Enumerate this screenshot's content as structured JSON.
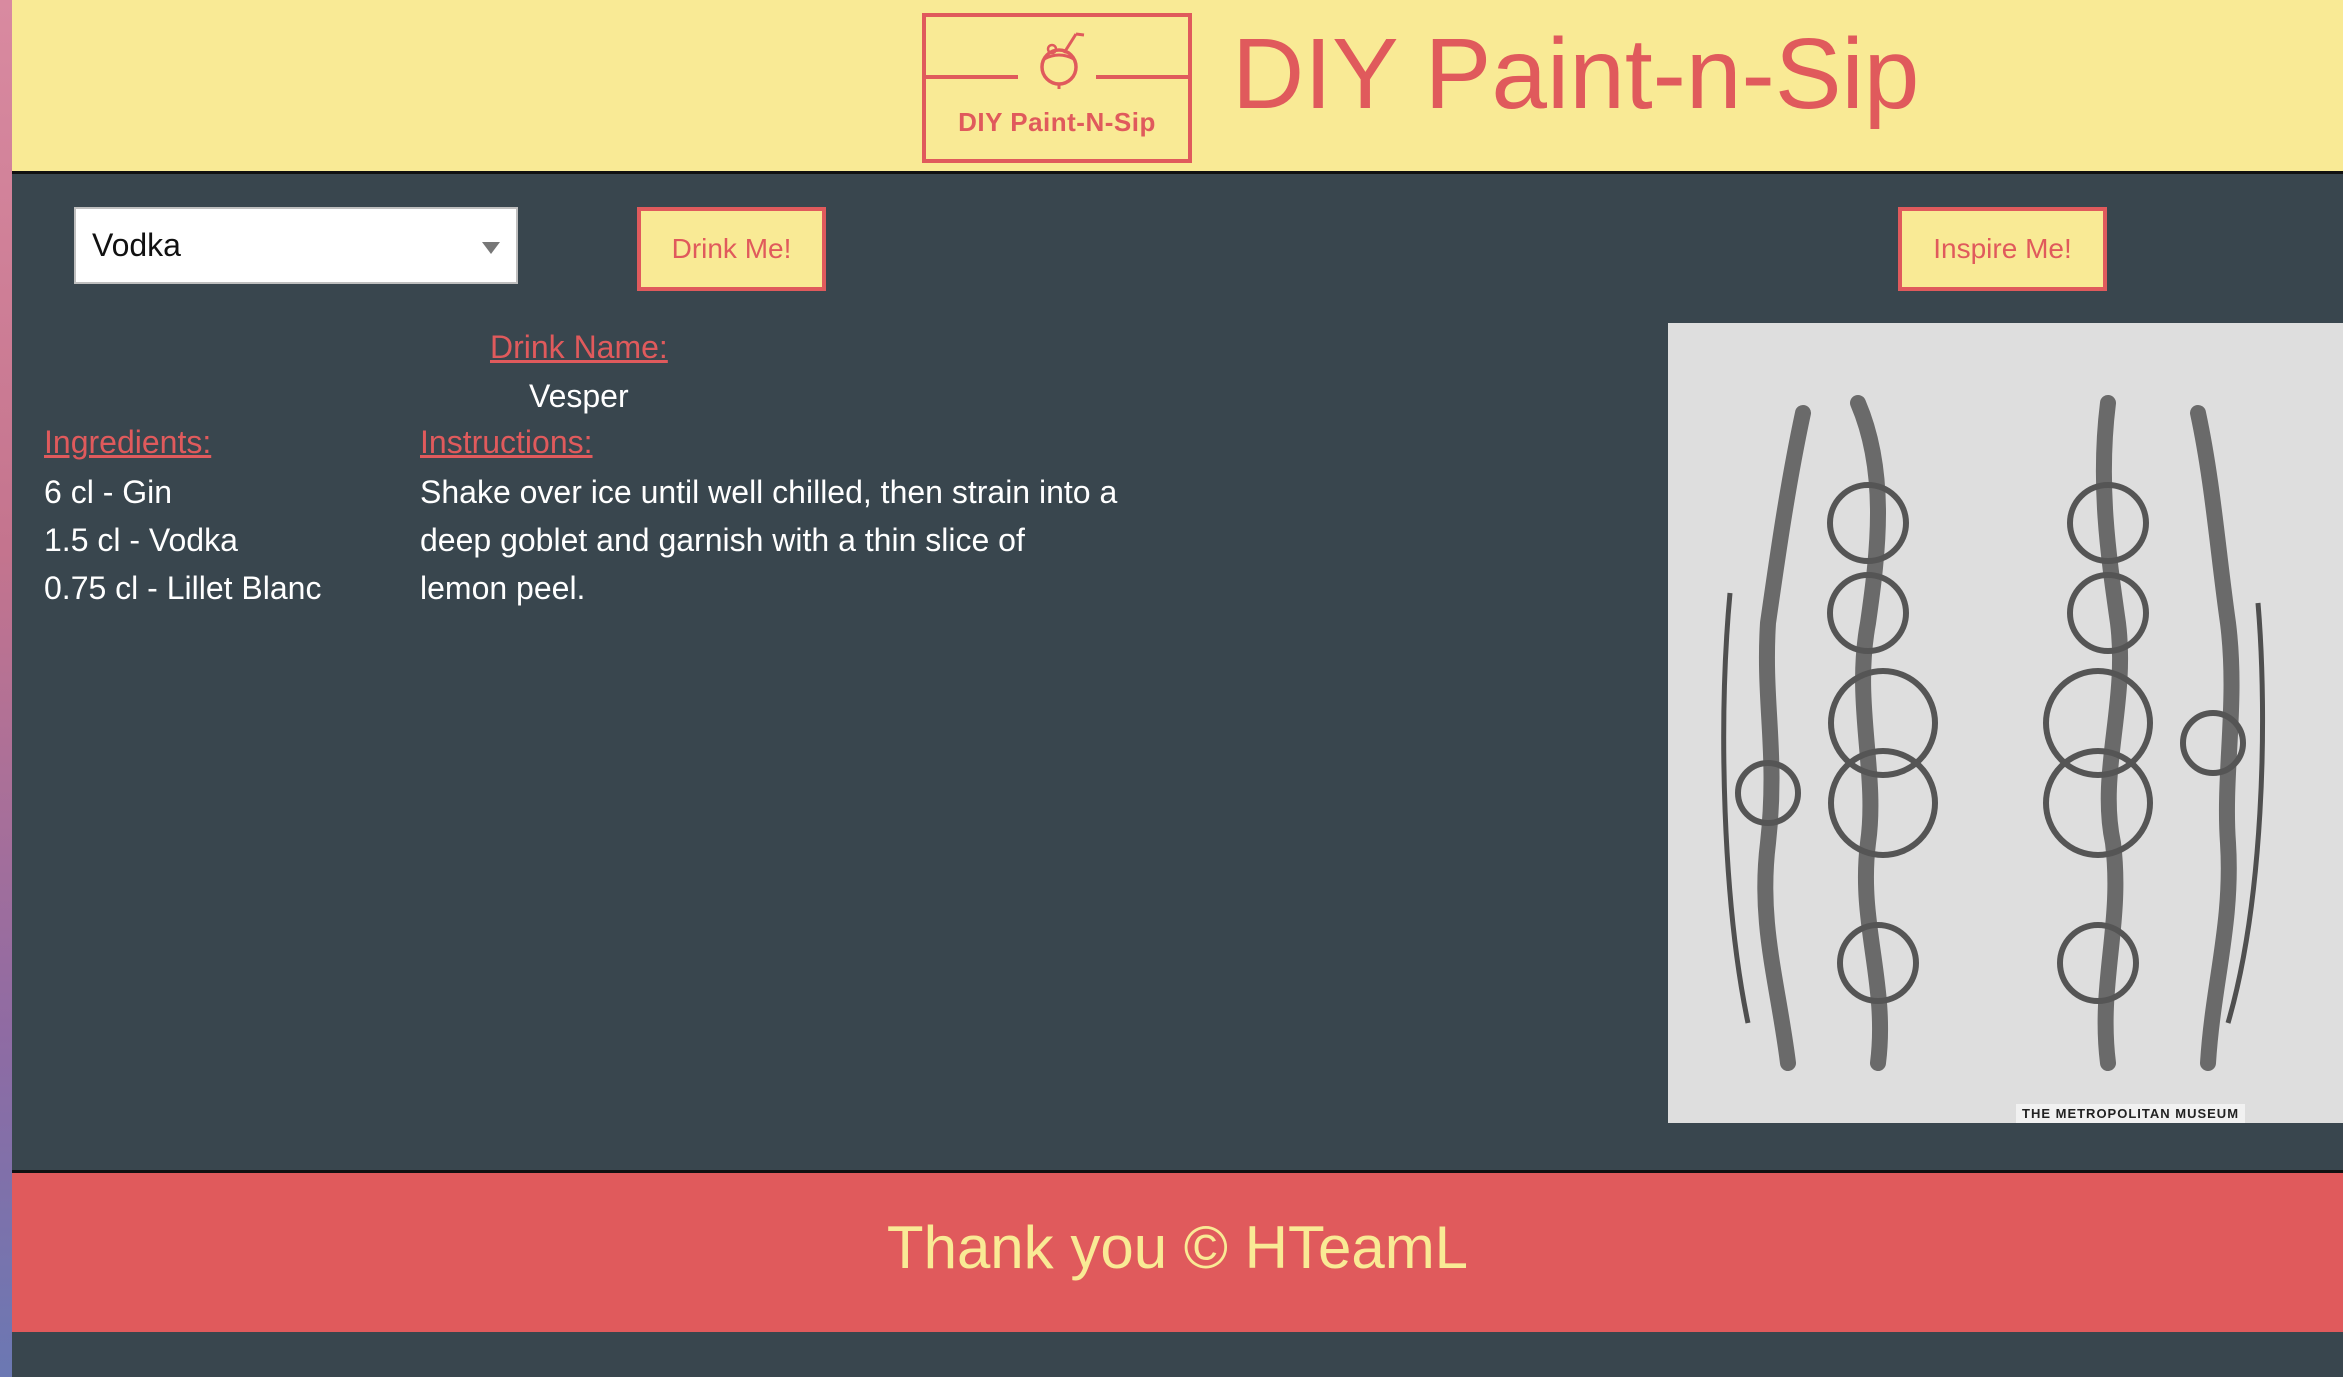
{
  "header": {
    "logo_text": "DIY Paint-N-Sip",
    "title": "DIY Paint-n-Sip"
  },
  "controls": {
    "selected_spirit": "Vodka",
    "drink_button": "Drink Me!",
    "inspire_button": "Inspire Me!"
  },
  "drink": {
    "name_label": "Drink Name:",
    "name": "Vesper",
    "ingredients_label": "Ingredients:",
    "ingredients": [
      "6 cl - Gin",
      "1.5 cl - Vodka",
      "0.75 cl - Lillet Blanc"
    ],
    "instructions_label": "Instructions:",
    "instructions": "Shake over ice until well chilled, then strain into a deep goblet and garnish with a thin slice of lemon peel."
  },
  "artwork": {
    "caption": "THE METROPOLITAN MUSEUM"
  },
  "footer": {
    "text": "Thank you © HTeamL"
  },
  "colors": {
    "header_bg": "#f9ea95",
    "accent": "#e05a5c",
    "page_bg": "#39464e"
  }
}
